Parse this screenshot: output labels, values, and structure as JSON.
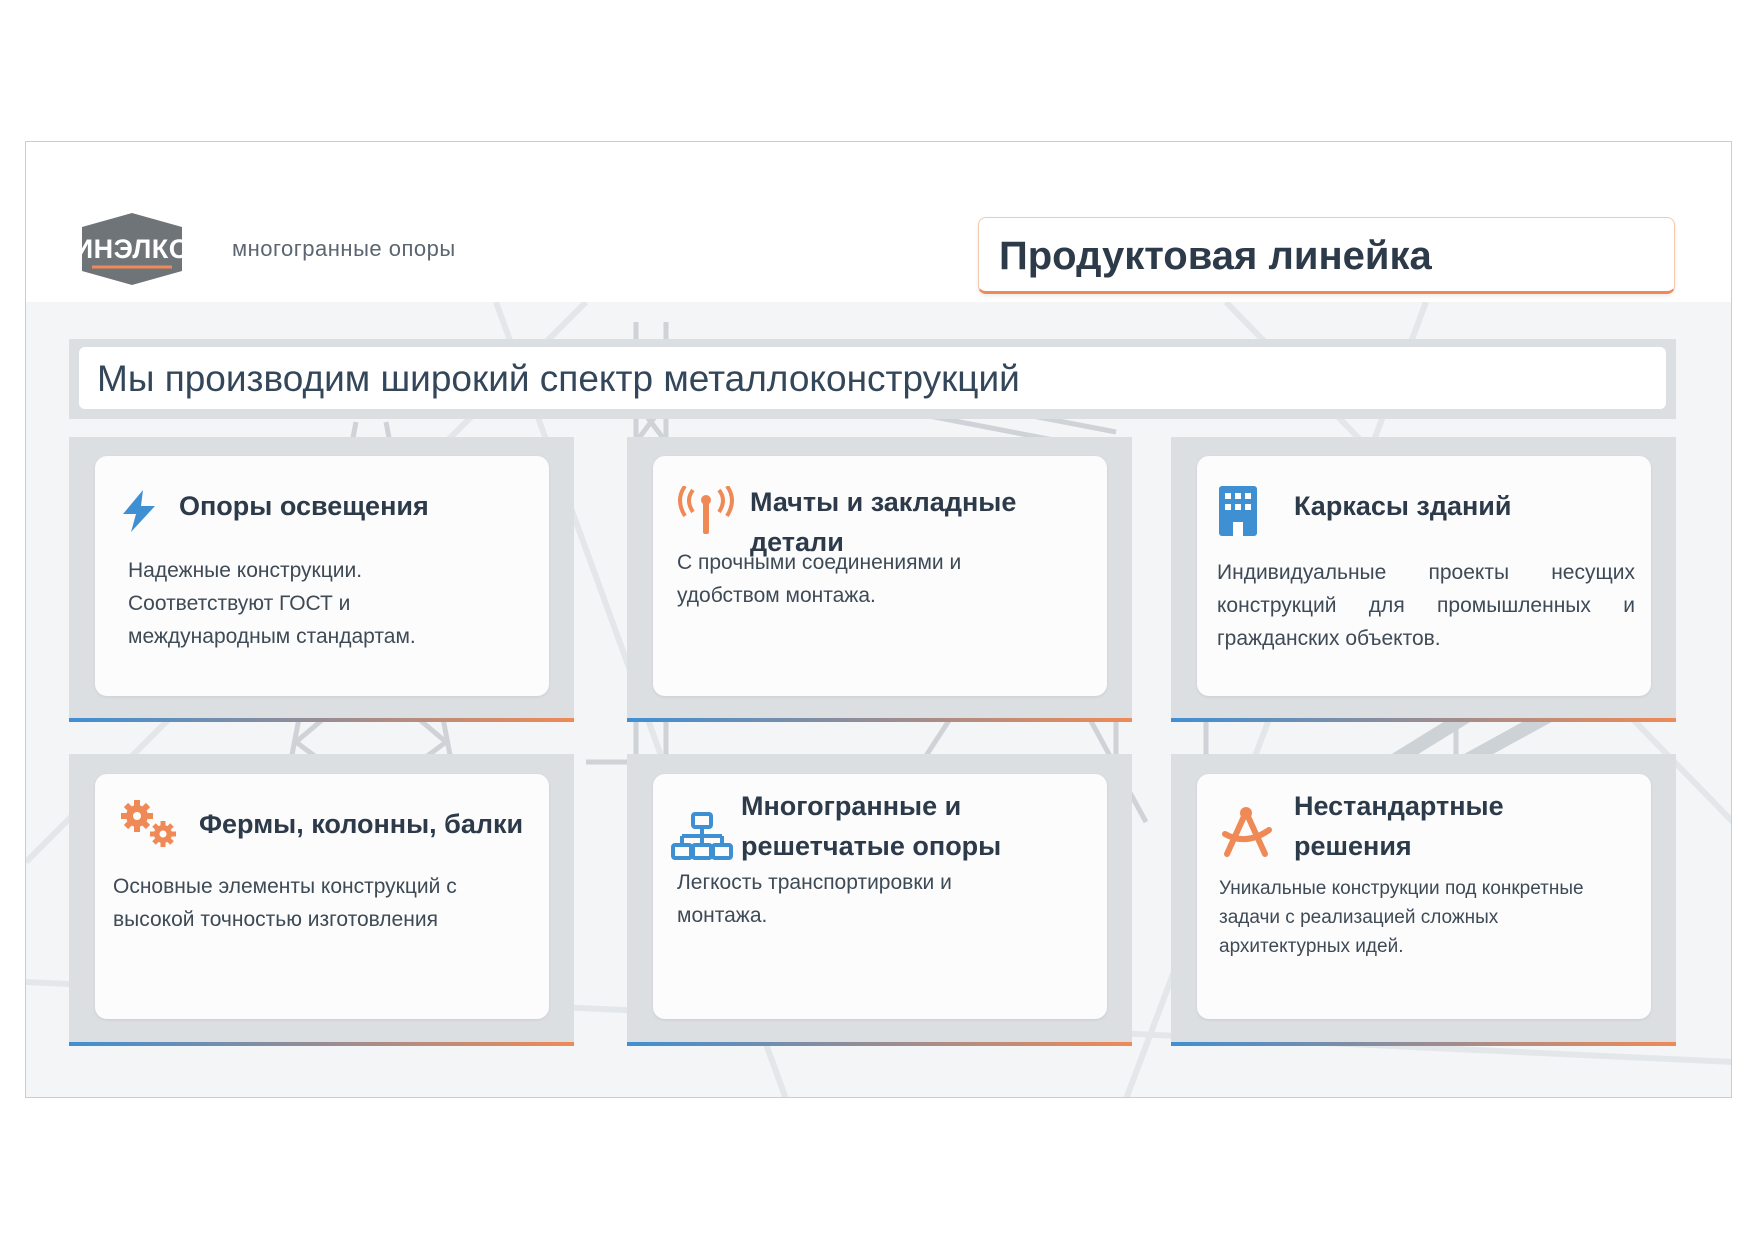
{
  "brand": {
    "logo_text": "ИНЭЛКО",
    "tagline": "многогранные опоры"
  },
  "header": {
    "title": "Продуктовая линейка"
  },
  "headline": "Мы производим широкий спектр металлоконструкций",
  "cards": [
    {
      "icon": "lightning-icon",
      "title": "Опоры освещения",
      "description": "Надежные конструкции. Соответствуют ГОСТ и международным стандартам."
    },
    {
      "icon": "antenna-icon",
      "title": "Мачты и закладные детали",
      "description": "С прочными соединениями и удобством монтажа."
    },
    {
      "icon": "building-icon",
      "title": "Каркасы зданий",
      "description": "Индивидуальные проекты несущих конструкций для промышленных и гражданских объектов."
    },
    {
      "icon": "gears-icon",
      "title": "Фермы, колонны, балки",
      "description": "Основные элементы конструкций с высокой точностью изготовления"
    },
    {
      "icon": "network-icon",
      "title": "Многогранные и решетчатые опоры",
      "description": "Легкость транспортировки и монтажа."
    },
    {
      "icon": "compass-icon",
      "title": "Нестандартные решения",
      "description": "Уникальные конструкции под конкретные задачи с реализацией сложных архитектурных идей."
    }
  ],
  "colors": {
    "accent_orange": "#ef8a56",
    "accent_blue": "#3f8fd3",
    "text_dark": "#2c3a4a",
    "logo_gray": "#6f7479"
  }
}
